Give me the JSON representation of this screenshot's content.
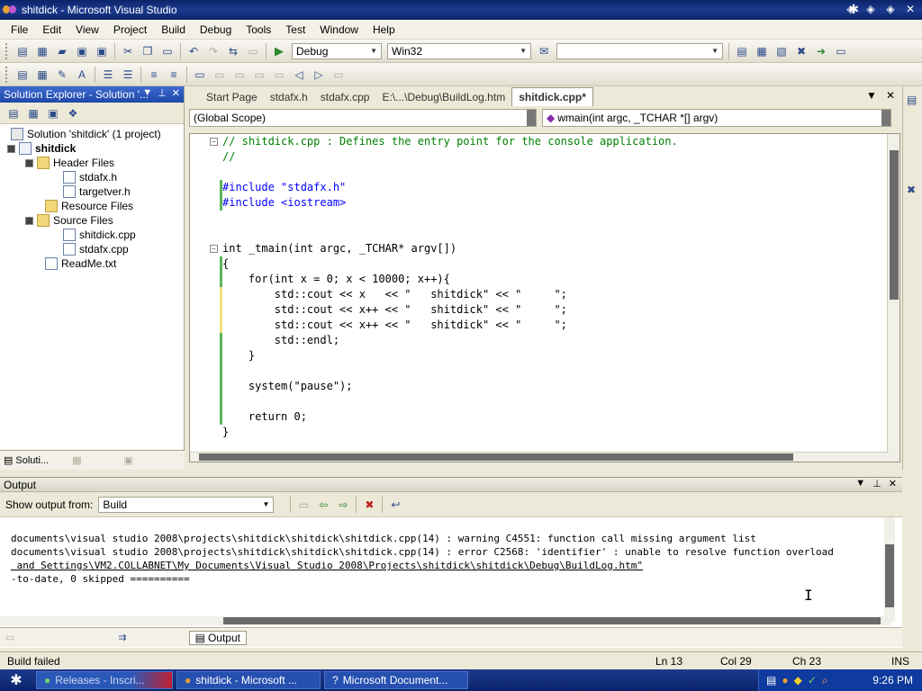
{
  "window": {
    "title": "shitdick - Microsoft Visual Studio"
  },
  "menu": [
    "File",
    "Edit",
    "View",
    "Project",
    "Build",
    "Debug",
    "Tools",
    "Test",
    "Window",
    "Help"
  ],
  "toolbar": {
    "config": "Debug",
    "platform": "Win32",
    "find_value": ""
  },
  "solution_explorer": {
    "title": "Solution Explorer - Solution '...",
    "tree": [
      {
        "label": "Solution 'shitdick' (1 project)",
        "depth": 0,
        "kind": "sln"
      },
      {
        "label": "shitdick",
        "depth": 0,
        "kind": "project",
        "bold": true
      },
      {
        "label": "Header Files",
        "depth": 1,
        "kind": "folder"
      },
      {
        "label": "stdafx.h",
        "depth": 2,
        "kind": "file"
      },
      {
        "label": "targetver.h",
        "depth": 2,
        "kind": "file"
      },
      {
        "label": "Resource Files",
        "depth": 1,
        "kind": "folder"
      },
      {
        "label": "Source Files",
        "depth": 1,
        "kind": "folder"
      },
      {
        "label": "shitdick.cpp",
        "depth": 2,
        "kind": "file"
      },
      {
        "label": "stdafx.cpp",
        "depth": 2,
        "kind": "file"
      },
      {
        "label": "ReadMe.txt",
        "depth": 1,
        "kind": "file"
      }
    ],
    "tabs": [
      "Soluti...",
      "",
      ""
    ]
  },
  "doc_tabs": [
    "Start Page",
    "stdafx.h",
    "stdafx.cpp",
    "E:\\...\\Debug\\BuildLog.htm",
    "shitdick.cpp*"
  ],
  "nav": {
    "scope": "(Global Scope)",
    "member": "wmain(int argc, _TCHAR *[] argv)"
  },
  "code_lines": [
    "// shitdick.cpp : Defines the entry point for the console application.",
    "//",
    "",
    "#include \"stdafx.h\"",
    "#include <iostream>",
    "",
    "",
    "int _tmain(int argc, _TCHAR* argv[])",
    "{",
    "    for(int x = 0; x < 10000; x++){",
    "        std::cout << x   << \"   shitdick\" << \"     \";",
    "        std::cout << x++ << \"   shitdick\" << \"     \";",
    "        std::cout << x++ << \"   shitdick\" << \"     \";",
    "        std::endl;",
    "    }",
    "",
    "    system(\"pause\");",
    "",
    "    return 0;",
    "}"
  ],
  "output": {
    "title": "Output",
    "show_from_label": "Show output from:",
    "show_from_value": "Build",
    "lines": [
      "documents\\visual studio 2008\\projects\\shitdick\\shitdick\\shitdick.cpp(14) : warning C4551: function call missing argument list",
      "documents\\visual studio 2008\\projects\\shitdick\\shitdick\\shitdick.cpp(14) : error C2568: 'identifier' : unable to resolve function overload",
      " and Settings\\VM2.COLLABNET\\My Documents\\Visual Studio 2008\\Projects\\shitdick\\shitdick\\Debug\\BuildLog.htm\"",
      "",
      "-to-date, 0 skipped =========="
    ],
    "tabs": [
      "",
      "",
      "Output"
    ]
  },
  "status": {
    "message": "Build failed",
    "ln": "Ln 13",
    "col": "Col 29",
    "ch": "Ch 23",
    "mode": "INS"
  },
  "taskbar": {
    "tasks": [
      "Releases - Inscri...",
      "shitdick - Microsoft ...",
      "Microsoft Document..."
    ],
    "clock": "9:26 PM"
  }
}
